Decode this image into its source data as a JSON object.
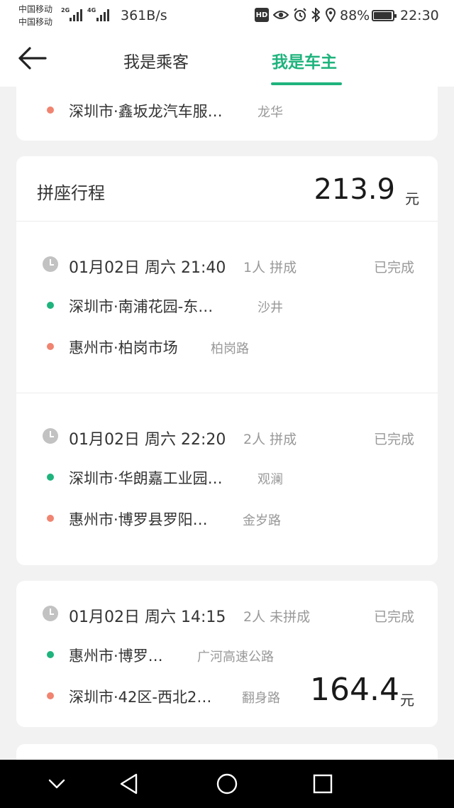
{
  "status_bar": {
    "carrier_1": "中国移动",
    "carrier_2": "中国移动",
    "signal_1": "2G",
    "signal_2": "4G",
    "net_speed": "361B/s",
    "hd": "HD",
    "battery_text": "88%",
    "battery_level": 0.88,
    "time": "22:30"
  },
  "header": {
    "tabs": [
      {
        "label": "我是乘客",
        "active": false
      },
      {
        "label": "我是车主",
        "active": true
      }
    ],
    "accent": "#1fb37d"
  },
  "top_card": {
    "to_addr": "深圳市·鑫坂龙汽车服…",
    "to_area": "龙华"
  },
  "pool_card": {
    "title": "拼座行程",
    "amount": "213.9",
    "unit": "元",
    "trips": [
      {
        "time": "01月02日 周六 21:40",
        "seats": "1人 拼成",
        "status": "已完成",
        "from_addr": "深圳市·南浦花园-东…",
        "from_area": "沙井",
        "to_addr": "惠州市·柏岗市场",
        "to_area": "柏岗路"
      },
      {
        "time": "01月02日 周六 22:20",
        "seats": "2人 拼成",
        "status": "已完成",
        "from_addr": "深圳市·华朗嘉工业园…",
        "from_area": "观澜",
        "to_addr": "惠州市·博罗县罗阳…",
        "to_area": "金岁路"
      }
    ]
  },
  "single_card": {
    "time": "01月02日 周六 14:15",
    "seats": "2人 未拼成",
    "status": "已完成",
    "from_addr": "惠州市·博罗…",
    "from_area": "广河高速公路",
    "to_addr": "深圳市·42区-西北2…",
    "to_area": "翻身路",
    "amount": "164.4",
    "unit": "元"
  },
  "colors": {
    "origin_dot": "#1fb37d",
    "destination_dot": "#f08470"
  }
}
